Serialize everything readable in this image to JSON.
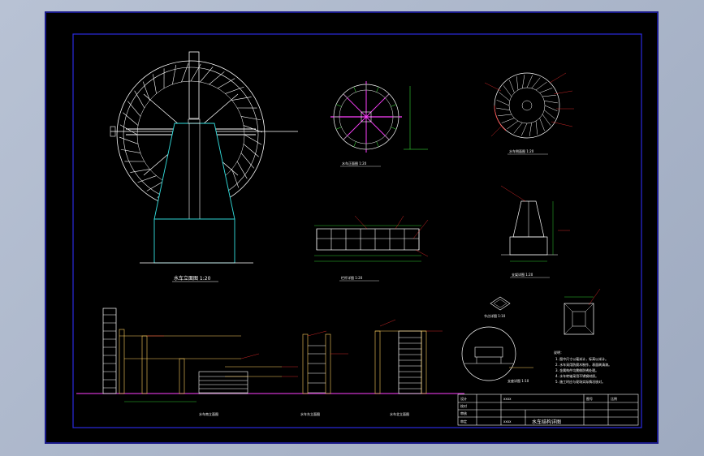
{
  "drawing": {
    "title_block": {
      "drawing_title": "水车结构详图",
      "row_labels": [
        "设计",
        "校对",
        "审核",
        "审定"
      ],
      "cells": [
        "xxxx",
        "xxxx",
        "图号",
        "比例"
      ]
    },
    "views": {
      "waterwheel_elevation": {
        "caption": "水车立面图 1:20"
      },
      "wheel_front": {
        "caption": "水车正面图 1:20"
      },
      "wheel_side": {
        "caption": "水车侧面图 1:20"
      },
      "rail_detail": {
        "caption": "栏杆详图 1:20"
      },
      "pier_detail": {
        "caption": "支架详图 1:20"
      },
      "cap_detail": {
        "caption": "柱帽详图 1:10"
      },
      "plate_detail": {
        "caption": "节点详图 1:10"
      },
      "round_detail": {
        "caption": "支座详图 1:10"
      },
      "elev_a": {
        "caption": "水车南立面图"
      },
      "elev_b": {
        "caption": "水车东立面图"
      },
      "elev_c": {
        "caption": "水车北立面图"
      }
    },
    "notes": {
      "heading": "说明：",
      "lines": [
        "1. 图中尺寸以毫米计，标高以米计。",
        "2. 水车采用防腐木制作，表面刷清漆。",
        "3. 金属构件均需做防锈处理。",
        "4. 水车转轴采用不锈钢材质。",
        "5. 施工时应与现场实际情况核对。"
      ]
    },
    "colors": {
      "background": "#000000",
      "border": "#1a1a8a",
      "structure": "#ffffff",
      "cyan": "#33e0e0",
      "magenta": "#ff40ff",
      "green": "#40ff40",
      "red": "#ff3030",
      "yellow": "#ffd060"
    }
  }
}
